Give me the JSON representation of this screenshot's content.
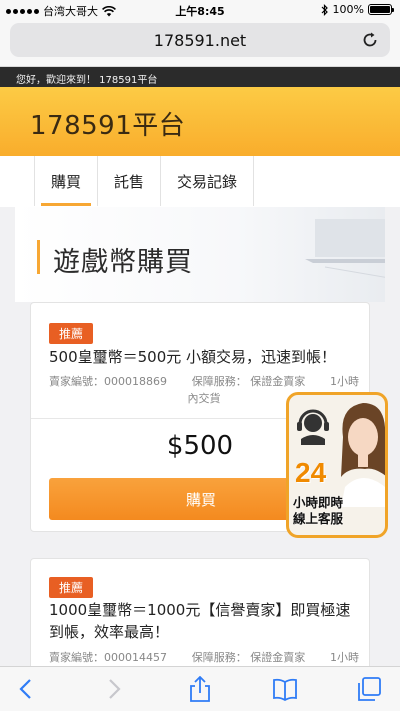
{
  "status_bar": {
    "carrier": "台湾大哥大",
    "time": "上午8:45",
    "battery": "100%",
    "battery_level": 1.0
  },
  "browser": {
    "url": "178591.net"
  },
  "page": {
    "greeting": "您好，歡迎來到！ 178591平台",
    "site_title": "178591平台",
    "nav": [
      {
        "label": "購買",
        "active": true
      },
      {
        "label": "託售",
        "active": false
      },
      {
        "label": "交易記錄",
        "active": false
      }
    ],
    "banner_title": "遊戲幣購買",
    "listings": [
      {
        "tag": "推薦",
        "title": "500皇璽幣＝500元 小額交易，迅速到帳！",
        "seller_label": "賣家編號：",
        "seller_id": "000018869",
        "service_label": "保障服務：",
        "service": "保證金賣家",
        "delivery_a": "1小時",
        "delivery_b": "內交貨",
        "price": "$500",
        "buy_label": "購買"
      },
      {
        "tag": "推薦",
        "title": "1000皇璽幣＝1000元【信譽賣家】即買極速到帳，效率最高！",
        "seller_label": "賣家編號：",
        "seller_id": "000014457",
        "service_label": "保障服務：",
        "service": "保證金賣家",
        "delivery_a": "1小時"
      }
    ]
  },
  "support_widget": {
    "number": "24",
    "line1": "小時即時",
    "line2": "線上客服"
  },
  "colors": {
    "accent": "#f7a733",
    "header_top": "#fccb45",
    "header_bottom": "#f9ad2c",
    "tag": "#e85f23",
    "button": "#f48a1f",
    "ios_blue": "#2f7cf6"
  }
}
